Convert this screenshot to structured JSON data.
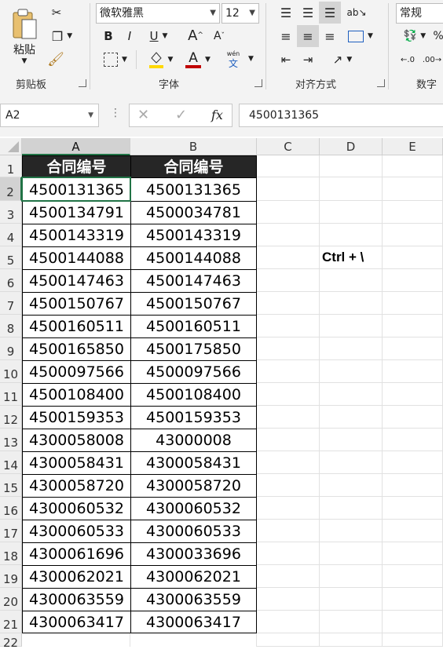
{
  "ribbon": {
    "clipboard": {
      "paste_label": "粘贴",
      "group_label": "剪贴板"
    },
    "font": {
      "font_name": "微软雅黑",
      "font_size": "12",
      "bold": "B",
      "italic": "I",
      "underline": "U",
      "grow_font": "A",
      "shrink_font": "A",
      "font_color_letter": "A",
      "phonetic_top": "wén",
      "phonetic_bottom": "文",
      "group_label": "字体"
    },
    "alignment": {
      "group_label": "对齐方式"
    },
    "number": {
      "format": "常规",
      "group_label": "数字"
    }
  },
  "formula_bar": {
    "name_box": "A2",
    "fx_label": "fx",
    "value": "4500131365"
  },
  "columns": [
    "A",
    "B",
    "C",
    "D",
    "E"
  ],
  "rows": [
    {
      "n": "1",
      "a": "合同编号",
      "b": "合同编号"
    },
    {
      "n": "2",
      "a": "4500131365",
      "b": "4500131365"
    },
    {
      "n": "3",
      "a": "4500134791",
      "b": "4500034781"
    },
    {
      "n": "4",
      "a": "4500143319",
      "b": "4500143319"
    },
    {
      "n": "5",
      "a": "4500144088",
      "b": "4500144088"
    },
    {
      "n": "6",
      "a": "4500147463",
      "b": "4500147463"
    },
    {
      "n": "7",
      "a": "4500150767",
      "b": "4500150767"
    },
    {
      "n": "8",
      "a": "4500160511",
      "b": "4500160511"
    },
    {
      "n": "9",
      "a": "4500165850",
      "b": "4500175850"
    },
    {
      "n": "10",
      "a": "4500097566",
      "b": "4500097566"
    },
    {
      "n": "11",
      "a": "4500108400",
      "b": "4500108400"
    },
    {
      "n": "12",
      "a": "4500159353",
      "b": "4500159353"
    },
    {
      "n": "13",
      "a": "4300058008",
      "b": "43000008"
    },
    {
      "n": "14",
      "a": "4300058431",
      "b": "4300058431"
    },
    {
      "n": "15",
      "a": "4300058720",
      "b": "4300058720"
    },
    {
      "n": "16",
      "a": "4300060532",
      "b": "4300060532"
    },
    {
      "n": "17",
      "a": "4300060533",
      "b": "4300060533"
    },
    {
      "n": "18",
      "a": "4300061696",
      "b": "4300033696"
    },
    {
      "n": "19",
      "a": "4300062021",
      "b": "4300062021"
    },
    {
      "n": "20",
      "a": "4300063559",
      "b": "4300063559"
    },
    {
      "n": "21",
      "a": "4300063417",
      "b": "4300063417"
    },
    {
      "n": "22",
      "a": "",
      "b": ""
    }
  ],
  "annotation": "Ctrl + \\",
  "colors": {
    "header_fill": "#262626",
    "header_text": "#ffffff",
    "selection_accent": "#217346",
    "font_color_bar": "#c00000",
    "highlight_bar": "#ffd800"
  }
}
